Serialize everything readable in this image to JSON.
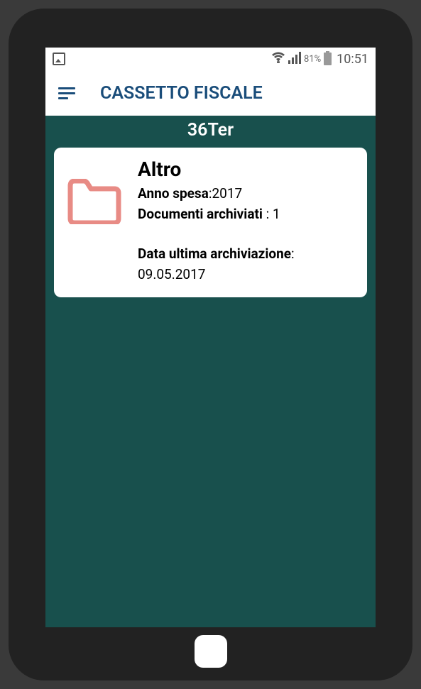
{
  "status": {
    "battery_pct": "81%",
    "clock": "10:51"
  },
  "app": {
    "title": "CASSETTO FISCALE"
  },
  "section": {
    "title": "36Ter"
  },
  "card": {
    "title": "Altro",
    "anno_label": "Anno spesa",
    "anno_value": ":2017",
    "doc_label": "Documenti archiviati",
    "doc_value": " : 1",
    "data_label": "Data ultima archiviazione",
    "data_suffix": ": ",
    "data_value": "09.05.2017"
  }
}
